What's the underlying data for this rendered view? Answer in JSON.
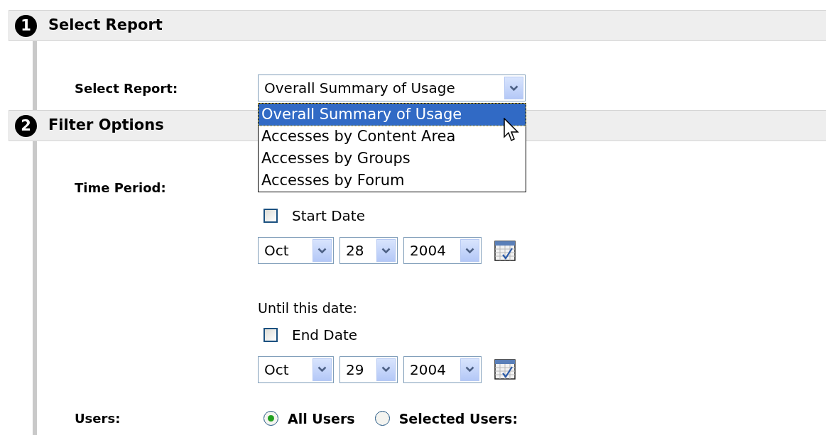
{
  "sections": [
    {
      "number": "1",
      "title": "Select Report",
      "fields": [
        {
          "kind": "dropdown",
          "label": "Select Report:",
          "value": "Overall Summary of Usage",
          "expanded": true,
          "options": [
            {
              "label": "Overall Summary of Usage",
              "selected": true
            },
            {
              "label": "Accesses by Content Area",
              "selected": false
            },
            {
              "label": "Accesses by Groups",
              "selected": false
            },
            {
              "label": "Accesses by Forum",
              "selected": false
            }
          ]
        }
      ]
    },
    {
      "number": "2",
      "title": "Filter Options",
      "fields": [
        {
          "kind": "date_range",
          "label": "Time Period:",
          "ranges": [
            {
              "checkbox": {
                "label": "Start Date",
                "checked": false
              },
              "month": "Oct",
              "day": "28",
              "year": "2004"
            },
            {
              "caption": "Until this date:",
              "checkbox": {
                "label": "End Date",
                "checked": false
              },
              "month": "Oct",
              "day": "29",
              "year": "2004"
            }
          ]
        },
        {
          "kind": "radio",
          "label": "Users:",
          "options": [
            {
              "label": "All Users",
              "selected": true
            },
            {
              "label": "Selected Users:",
              "selected": false
            }
          ]
        }
      ]
    }
  ]
}
